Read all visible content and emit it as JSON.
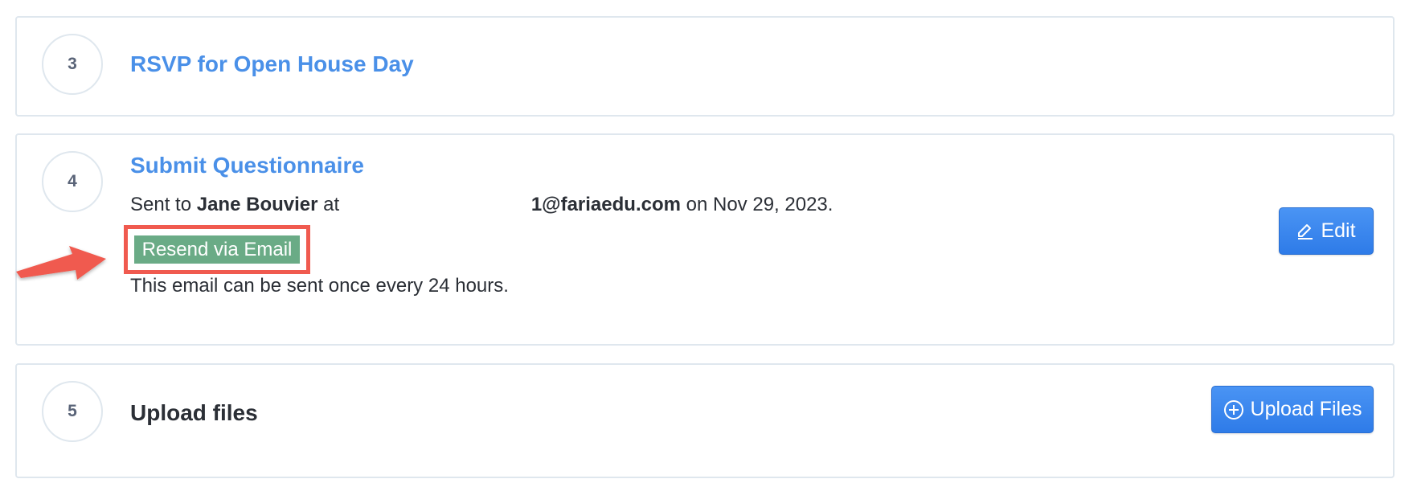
{
  "steps": [
    {
      "number": "3",
      "title": "RSVP for Open House Day"
    },
    {
      "number": "4",
      "title": "Submit Questionnaire",
      "sent_prefix": "Sent to",
      "recipient_name": "Jane Bouvier",
      "at_text": "at",
      "email": "1@fariaedu.com",
      "date_text": "on Nov 29, 2023.",
      "resend_label": "Resend via Email",
      "note": "This email can be sent once every 24 hours.",
      "edit_label": "Edit"
    },
    {
      "number": "5",
      "title": "Upload files",
      "upload_label": "Upload Files"
    }
  ],
  "colors": {
    "link": "#4a90e8",
    "primary_button": "#3584ee",
    "resend_button": "#6aab86",
    "annotation": "#f05a4f"
  },
  "icons": [
    "pencil-icon",
    "plus-circle-icon",
    "annotation-arrow-icon"
  ]
}
